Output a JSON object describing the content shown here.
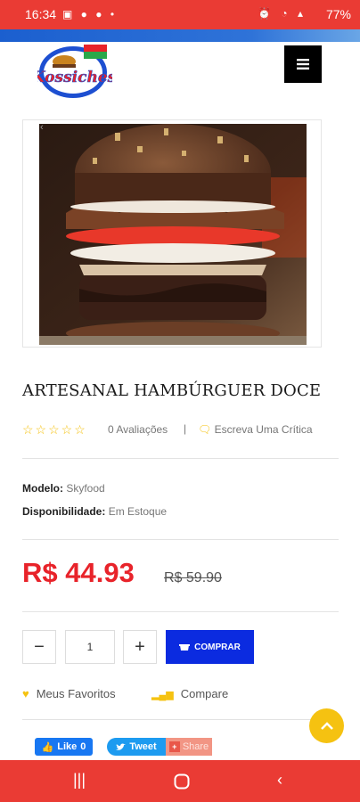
{
  "status_bar": {
    "time": "16:34",
    "battery": "77%"
  },
  "header": {
    "menu_icon": "hamburger-menu-icon",
    "logo_text": "Kossiches"
  },
  "product": {
    "title": "ARTESANAL HAMBÚRGUER DOCE",
    "reviews": "0 Avaliações",
    "separator": "|",
    "write_review": "Escreva Uma Crítica",
    "model_label": "Modelo:",
    "model_value": "Skyfood",
    "availability_label": "Disponibilidade:",
    "availability_value": "Em Estoque",
    "price": "R$ 44.93",
    "old_price": "R$ 59.90",
    "quantity": "1",
    "buy_label": "COMPRAR",
    "favorites_label": "Meus Favoritos",
    "compare_label": "Compare"
  },
  "social": {
    "like_label": "Like",
    "like_count": "0",
    "tweet_label": "Tweet",
    "share_label": "Share"
  },
  "colors": {
    "accent_red": "#e8232a",
    "buy_blue": "#0b2be0",
    "star_yellow": "#f5c211",
    "status_red": "#ea3b34"
  }
}
